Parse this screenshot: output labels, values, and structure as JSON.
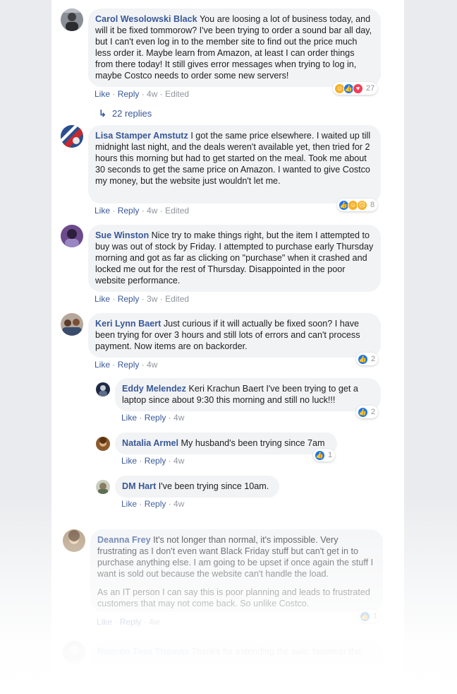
{
  "comments": [
    {
      "author": "Carol Wesolowski Black",
      "text": "You are loosing a lot of business today, and will it be fixed tommorow? I've been trying to order a sound bar all day, but I can't even log in to the member site to find out the price much less order it. Maybe learn from Amazon, at least I can order things from there today! It still gives error messages when trying to log in, maybe Costco needs to order some new servers!",
      "like": "Like",
      "reply": "Reply",
      "time": "4w",
      "edited": "Edited",
      "reaction_count": "27"
    },
    {
      "author": "Lisa Stamper Amstutz",
      "text": "I got the same price elsewhere. I waited up till\nmidnight last night, and the deals weren't available yet, then tried for 2 hours this morning but had to get started on the meal. Took me about 30 seconds to get the same price on Amazon. I wanted to give Costco my money, but the website just wouldn't let me.",
      "like": "Like",
      "reply": "Reply",
      "time": "4w",
      "edited": "Edited",
      "reaction_count": "8"
    },
    {
      "author": "Sue Winston",
      "text": "Nice try to make things right, but the item I attempted to buy was out of stock by Friday. I attempted to purchase early Thursday morning and got as far as clicking on \"purchase\" when it crashed and locked me out for the rest of Thursday. Disappointed in the poor website performance.",
      "like": "Like",
      "reply": "Reply",
      "time": "3w",
      "edited": "Edited"
    },
    {
      "author": "Keri Lynn Baert",
      "text": "Just curious if it will actually be fixed soon? I have been trying for over 3 hours and still lots of errors and can't process payment. Now items are on backorder.",
      "like": "Like",
      "reply": "Reply",
      "time": "4w",
      "reaction_count": "2"
    },
    {
      "author": "Deanna Frey",
      "text": "It's not longer than normal, it's impossible. Very frustrating as I don't even want Black Friday stuff but can't get in to purchase anything else. I am going to be upset if once again the stuff I want is sold out because the website can't handle the load.",
      "text2": "As an IT person I can say this is poor planning and leads to frustrated customers that may not come back. So unlike Costco.",
      "like": "Like",
      "reply": "Reply",
      "time": "4w",
      "reaction_count": "1"
    },
    {
      "author": "Nannon Tesa Thomas",
      "text": "Thanks for extending the sale, however the"
    }
  ],
  "replies_link": {
    "arrow": "↳",
    "label": "22 replies"
  },
  "replies": [
    {
      "author": "Eddy Melendez",
      "text": "Keri Krachun Baert I've been trying to get a laptop since about 9:30 this morning and still no luck!!!",
      "like": "Like",
      "reply": "Reply",
      "time": "4w",
      "reaction_count": "2"
    },
    {
      "author": "Natalia Armel",
      "text": "My husband's been trying since 7am",
      "like": "Like",
      "reply": "Reply",
      "time": "4w",
      "reaction_count": "1"
    },
    {
      "author": "DM Hart",
      "text": "I've been trying since 10am.",
      "like": "Like",
      "reply": "Reply",
      "time": "4w"
    }
  ],
  "colors": {
    "page_bg": "#e9ebee",
    "panel_bg": "#ffffff",
    "bubble_bg": "#f2f3f5",
    "author": "#385898",
    "meta": "#90949c",
    "like_blue": "#1877f2"
  }
}
